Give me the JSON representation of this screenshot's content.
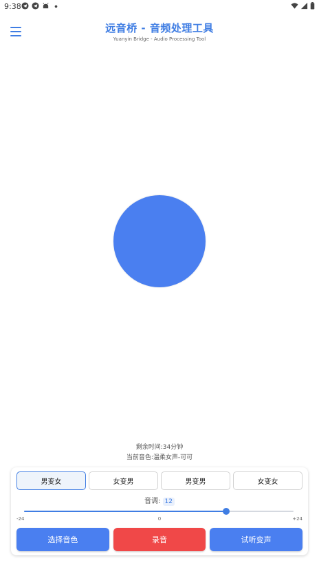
{
  "status_bar": {
    "time": "9:38",
    "left_icons": [
      "telegram-icon",
      "telegram-icon",
      "android-icon",
      "dot-icon"
    ],
    "right_icons": [
      "wifi-icon",
      "signal-icon",
      "battery-icon"
    ]
  },
  "header": {
    "menu_icon": "hamburger-icon",
    "title": "远音桥 - 音频处理工具",
    "subtitle": "Yuanyin Bridge - Audio Processing Tool"
  },
  "record": {
    "color": "#4a7ff0"
  },
  "info": {
    "remaining_time": "剩余时间:34分钟",
    "current_voice": "当前音色:温柔女声-可可"
  },
  "modes": [
    {
      "label": "男变女",
      "active": true
    },
    {
      "label": "女变男",
      "active": false
    },
    {
      "label": "男变男",
      "active": false
    },
    {
      "label": "女变女",
      "active": false
    }
  ],
  "pitch": {
    "label": "音调:",
    "value": "12",
    "min": -24,
    "max": 24,
    "current": 12,
    "min_label": "-24",
    "mid_label": "0",
    "max_label": "+24"
  },
  "actions": {
    "select_voice": "选择音色",
    "record": "录音",
    "preview": "试听变声"
  },
  "colors": {
    "accent": "#3f7de3",
    "primary_button": "#4a7ff0",
    "record_button": "#f04848"
  }
}
